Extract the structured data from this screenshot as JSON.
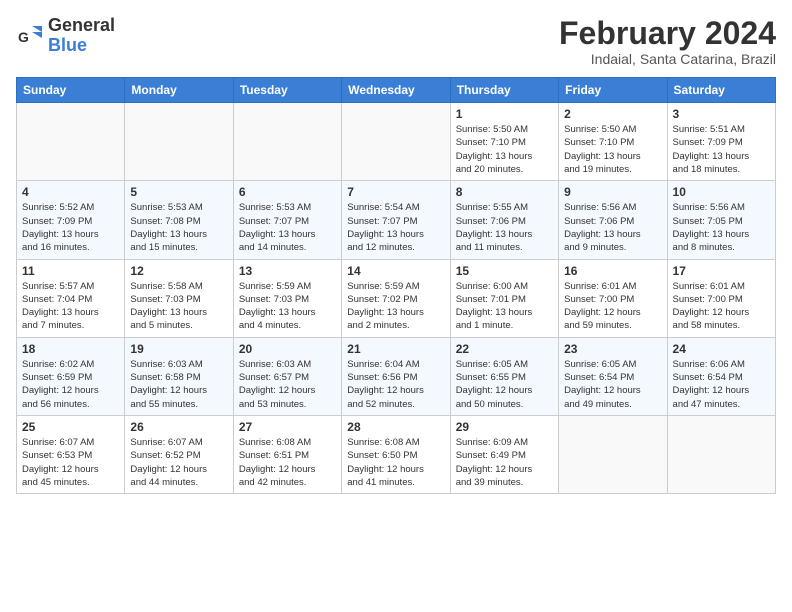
{
  "logo": {
    "line1": "General",
    "line2": "Blue"
  },
  "title": "February 2024",
  "subtitle": "Indaial, Santa Catarina, Brazil",
  "days_of_week": [
    "Sunday",
    "Monday",
    "Tuesday",
    "Wednesday",
    "Thursday",
    "Friday",
    "Saturday"
  ],
  "weeks": [
    [
      {
        "day": "",
        "info": ""
      },
      {
        "day": "",
        "info": ""
      },
      {
        "day": "",
        "info": ""
      },
      {
        "day": "",
        "info": ""
      },
      {
        "day": "1",
        "info": "Sunrise: 5:50 AM\nSunset: 7:10 PM\nDaylight: 13 hours\nand 20 minutes."
      },
      {
        "day": "2",
        "info": "Sunrise: 5:50 AM\nSunset: 7:10 PM\nDaylight: 13 hours\nand 19 minutes."
      },
      {
        "day": "3",
        "info": "Sunrise: 5:51 AM\nSunset: 7:09 PM\nDaylight: 13 hours\nand 18 minutes."
      }
    ],
    [
      {
        "day": "4",
        "info": "Sunrise: 5:52 AM\nSunset: 7:09 PM\nDaylight: 13 hours\nand 16 minutes."
      },
      {
        "day": "5",
        "info": "Sunrise: 5:53 AM\nSunset: 7:08 PM\nDaylight: 13 hours\nand 15 minutes."
      },
      {
        "day": "6",
        "info": "Sunrise: 5:53 AM\nSunset: 7:07 PM\nDaylight: 13 hours\nand 14 minutes."
      },
      {
        "day": "7",
        "info": "Sunrise: 5:54 AM\nSunset: 7:07 PM\nDaylight: 13 hours\nand 12 minutes."
      },
      {
        "day": "8",
        "info": "Sunrise: 5:55 AM\nSunset: 7:06 PM\nDaylight: 13 hours\nand 11 minutes."
      },
      {
        "day": "9",
        "info": "Sunrise: 5:56 AM\nSunset: 7:06 PM\nDaylight: 13 hours\nand 9 minutes."
      },
      {
        "day": "10",
        "info": "Sunrise: 5:56 AM\nSunset: 7:05 PM\nDaylight: 13 hours\nand 8 minutes."
      }
    ],
    [
      {
        "day": "11",
        "info": "Sunrise: 5:57 AM\nSunset: 7:04 PM\nDaylight: 13 hours\nand 7 minutes."
      },
      {
        "day": "12",
        "info": "Sunrise: 5:58 AM\nSunset: 7:03 PM\nDaylight: 13 hours\nand 5 minutes."
      },
      {
        "day": "13",
        "info": "Sunrise: 5:59 AM\nSunset: 7:03 PM\nDaylight: 13 hours\nand 4 minutes."
      },
      {
        "day": "14",
        "info": "Sunrise: 5:59 AM\nSunset: 7:02 PM\nDaylight: 13 hours\nand 2 minutes."
      },
      {
        "day": "15",
        "info": "Sunrise: 6:00 AM\nSunset: 7:01 PM\nDaylight: 13 hours\nand 1 minute."
      },
      {
        "day": "16",
        "info": "Sunrise: 6:01 AM\nSunset: 7:00 PM\nDaylight: 12 hours\nand 59 minutes."
      },
      {
        "day": "17",
        "info": "Sunrise: 6:01 AM\nSunset: 7:00 PM\nDaylight: 12 hours\nand 58 minutes."
      }
    ],
    [
      {
        "day": "18",
        "info": "Sunrise: 6:02 AM\nSunset: 6:59 PM\nDaylight: 12 hours\nand 56 minutes."
      },
      {
        "day": "19",
        "info": "Sunrise: 6:03 AM\nSunset: 6:58 PM\nDaylight: 12 hours\nand 55 minutes."
      },
      {
        "day": "20",
        "info": "Sunrise: 6:03 AM\nSunset: 6:57 PM\nDaylight: 12 hours\nand 53 minutes."
      },
      {
        "day": "21",
        "info": "Sunrise: 6:04 AM\nSunset: 6:56 PM\nDaylight: 12 hours\nand 52 minutes."
      },
      {
        "day": "22",
        "info": "Sunrise: 6:05 AM\nSunset: 6:55 PM\nDaylight: 12 hours\nand 50 minutes."
      },
      {
        "day": "23",
        "info": "Sunrise: 6:05 AM\nSunset: 6:54 PM\nDaylight: 12 hours\nand 49 minutes."
      },
      {
        "day": "24",
        "info": "Sunrise: 6:06 AM\nSunset: 6:54 PM\nDaylight: 12 hours\nand 47 minutes."
      }
    ],
    [
      {
        "day": "25",
        "info": "Sunrise: 6:07 AM\nSunset: 6:53 PM\nDaylight: 12 hours\nand 45 minutes."
      },
      {
        "day": "26",
        "info": "Sunrise: 6:07 AM\nSunset: 6:52 PM\nDaylight: 12 hours\nand 44 minutes."
      },
      {
        "day": "27",
        "info": "Sunrise: 6:08 AM\nSunset: 6:51 PM\nDaylight: 12 hours\nand 42 minutes."
      },
      {
        "day": "28",
        "info": "Sunrise: 6:08 AM\nSunset: 6:50 PM\nDaylight: 12 hours\nand 41 minutes."
      },
      {
        "day": "29",
        "info": "Sunrise: 6:09 AM\nSunset: 6:49 PM\nDaylight: 12 hours\nand 39 minutes."
      },
      {
        "day": "",
        "info": ""
      },
      {
        "day": "",
        "info": ""
      }
    ]
  ]
}
